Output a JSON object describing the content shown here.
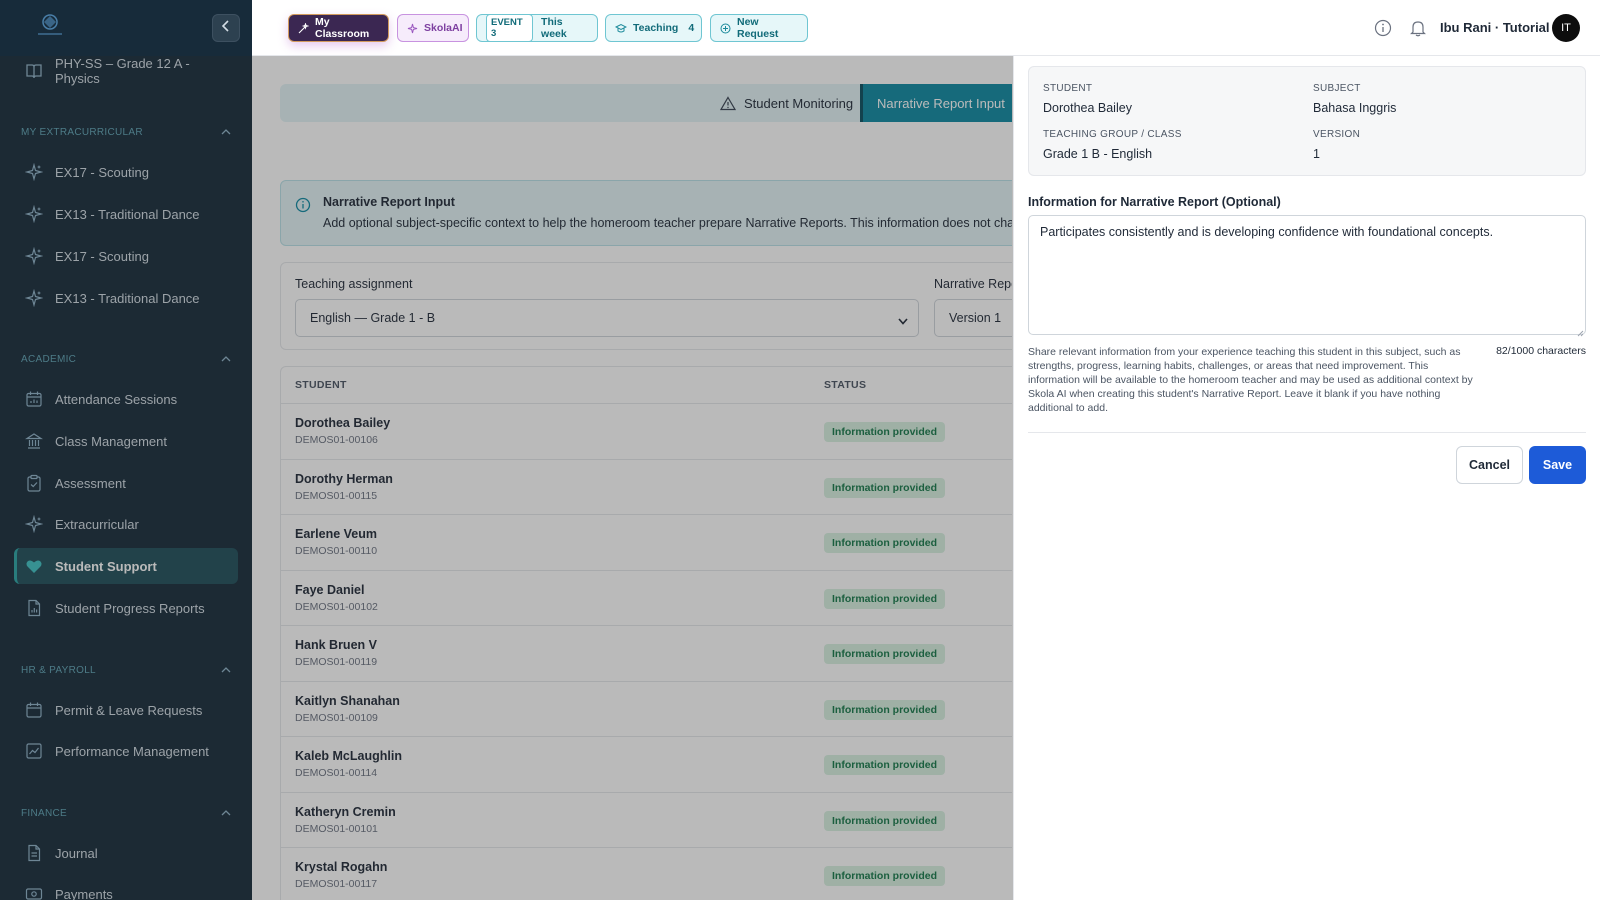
{
  "sidebar": {
    "top_item": "PHY-SS – Grade 12 A - Physics",
    "sections": {
      "extracurricular": "MY EXTRACURRICULAR",
      "academic": "ACADEMIC",
      "hr": "HR & PAYROLL",
      "finance": "FINANCE"
    },
    "extracurricular_items": [
      "EX17 - Scouting",
      "EX13 - Traditional Dance",
      "EX17 - Scouting",
      "EX13 - Traditional Dance"
    ],
    "academic_items": [
      "Attendance Sessions",
      "Class Management",
      "Assessment",
      "Extracurricular",
      "Student Support",
      "Student Progress Reports"
    ],
    "hr_items": [
      "Permit & Leave Requests",
      "Performance Management"
    ],
    "finance_items": [
      "Journal",
      "Payments"
    ],
    "active_item": "Student Support"
  },
  "topbar": {
    "classroom": "My Classroom",
    "skola": "SkolaAI",
    "event_tag": "EVENT 3",
    "event_label": "This week",
    "teaching_label": "Teaching",
    "teaching_count": "4",
    "new_request": "New Request",
    "user_name": "Ibu Rani · Tutorial",
    "avatar_initials": "IT"
  },
  "main": {
    "tab_monitoring": "Student Monitoring",
    "tab_narrative": "Narrative Report Input",
    "info_title": "Narrative Report Input",
    "info_text": "Add optional subject-specific context to help the homeroom teacher prepare Narrative Reports. This information does not chang",
    "teaching_assignment_label": "Teaching assignment",
    "teaching_assignment_value": "English — Grade 1 - B",
    "narrative_label": "Narrative Repo",
    "narrative_value": "Version 1",
    "col_student": "STUDENT",
    "col_status": "STATUS",
    "rows": [
      {
        "name": "Dorothea Bailey",
        "id": "DEMOS01-00106",
        "status": "Information provided"
      },
      {
        "name": "Dorothy Herman",
        "id": "DEMOS01-00115",
        "status": "Information provided"
      },
      {
        "name": "Earlene Veum",
        "id": "DEMOS01-00110",
        "status": "Information provided"
      },
      {
        "name": "Faye Daniel",
        "id": "DEMOS01-00102",
        "status": "Information provided"
      },
      {
        "name": "Hank Bruen V",
        "id": "DEMOS01-00119",
        "status": "Information provided"
      },
      {
        "name": "Kaitlyn Shanahan",
        "id": "DEMOS01-00109",
        "status": "Information provided"
      },
      {
        "name": "Kaleb McLaughlin",
        "id": "DEMOS01-00114",
        "status": "Information provided"
      },
      {
        "name": "Katheryn Cremin",
        "id": "DEMOS01-00101",
        "status": "Information provided"
      },
      {
        "name": "Krystal Rogahn",
        "id": "DEMOS01-00117",
        "status": "Information provided"
      }
    ]
  },
  "panel": {
    "student_key": "STUDENT",
    "student_value": "Dorothea Bailey",
    "subject_key": "SUBJECT",
    "subject_value": "Bahasa Inggris",
    "group_key": "TEACHING GROUP / CLASS",
    "group_value": "Grade 1 B - English",
    "version_key": "VERSION",
    "version_value": "1",
    "field_label": "Information for Narrative Report (Optional)",
    "field_value": "Participates consistently and is developing confidence with foundational concepts.",
    "hint": "Share relevant information from your experience teaching this student in this subject, such as strengths, progress, learning habits, challenges, or areas that need improvement. This information will be available to the homeroom teacher and may be used as additional context by Skola AI when creating this student's Narrative Report. Leave it blank if you have nothing additional to add.",
    "counter": "82/1000 characters",
    "cancel": "Cancel",
    "save": "Save"
  },
  "colors": {
    "sidebar_bg": "#172b3a",
    "accent_teal": "#0e8aa3",
    "save_blue": "#1d5bd8",
    "badge_green": "#16794a"
  },
  "icons": [
    "logo",
    "collapse-chevron-icon",
    "book-icon",
    "sparkle-icon",
    "calendar-icon",
    "bank-icon",
    "clipboard-icon",
    "heart-icon",
    "report-icon",
    "chart-icon",
    "info-icon",
    "bell-icon",
    "warning-icon"
  ]
}
